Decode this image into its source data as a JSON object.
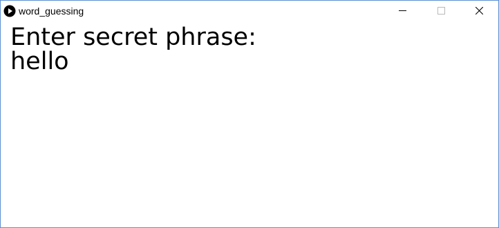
{
  "window": {
    "title": "word_guessing",
    "app_icon": "play-circle-icon",
    "controls": {
      "minimize_icon": "minimize-icon",
      "maximize_icon": "maximize-icon",
      "close_icon": "close-icon"
    },
    "border_color": "#5a8fd1"
  },
  "content": {
    "prompt": "Enter secret phrase:",
    "input_value": "hello"
  }
}
